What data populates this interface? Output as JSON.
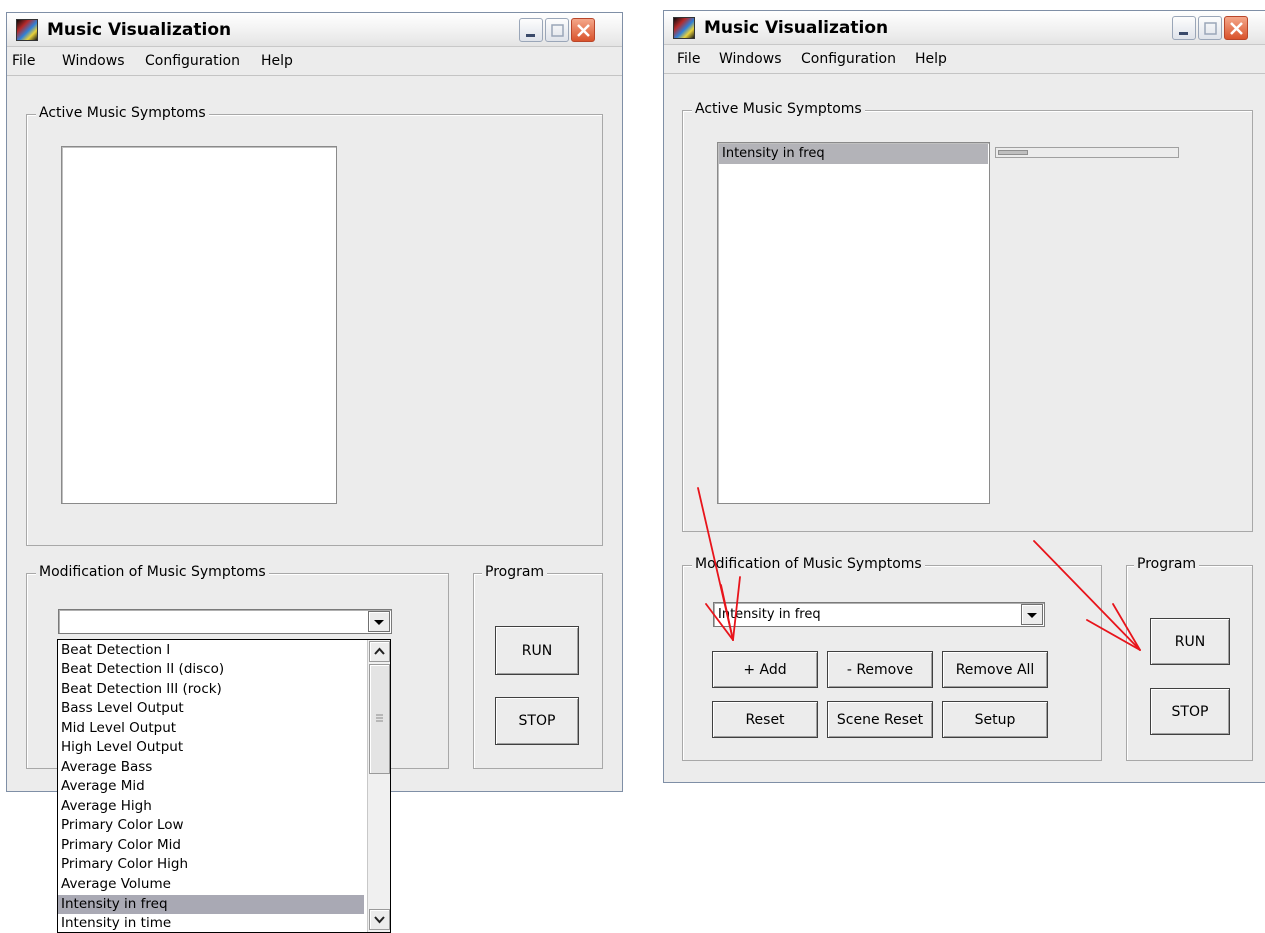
{
  "left_window": {
    "title": "Music Visualization",
    "menu": [
      "File",
      "Windows",
      "Configuration",
      "Help"
    ],
    "active_group_label": "Active Music Symptoms",
    "modification_group_label": "Modification of Music Symptoms",
    "program_group_label": "Program",
    "combo_value": "",
    "run_label": "RUN",
    "stop_label": "STOP",
    "dropdown_items": [
      "Beat Detection I",
      "Beat Detection II (disco)",
      "Beat Detection III (rock)",
      "Bass Level Output",
      "Mid Level Output",
      "High Level Output",
      "Average Bass",
      "Average Mid",
      "Average High",
      "Primary Color Low",
      "Primary Color Mid",
      "Primary Color High",
      "Average Volume",
      "Intensity in freq",
      "Intensity in time"
    ],
    "dropdown_selected": "Intensity in freq"
  },
  "right_window": {
    "title": "Music Visualization",
    "menu": [
      "File",
      "Windows",
      "Configuration",
      "Help"
    ],
    "active_group_label": "Active Music Symptoms",
    "active_list": [
      "Intensity in freq"
    ],
    "progress_fraction": 0.17,
    "modification_group_label": "Modification of Music Symptoms",
    "combo_value": "Intensity in freq",
    "buttons": {
      "add": "+ Add",
      "remove": "- Remove",
      "remove_all": "Remove All",
      "reset": "Reset",
      "scene_reset": "Scene Reset",
      "setup": "Setup"
    },
    "program_group_label": "Program",
    "run_label": "RUN",
    "stop_label": "STOP"
  },
  "colors": {
    "window_bg": "#ececec",
    "close_button": "#d9532c",
    "annotation_arrow": "#e8141b",
    "selection": "#a9a9b4"
  }
}
